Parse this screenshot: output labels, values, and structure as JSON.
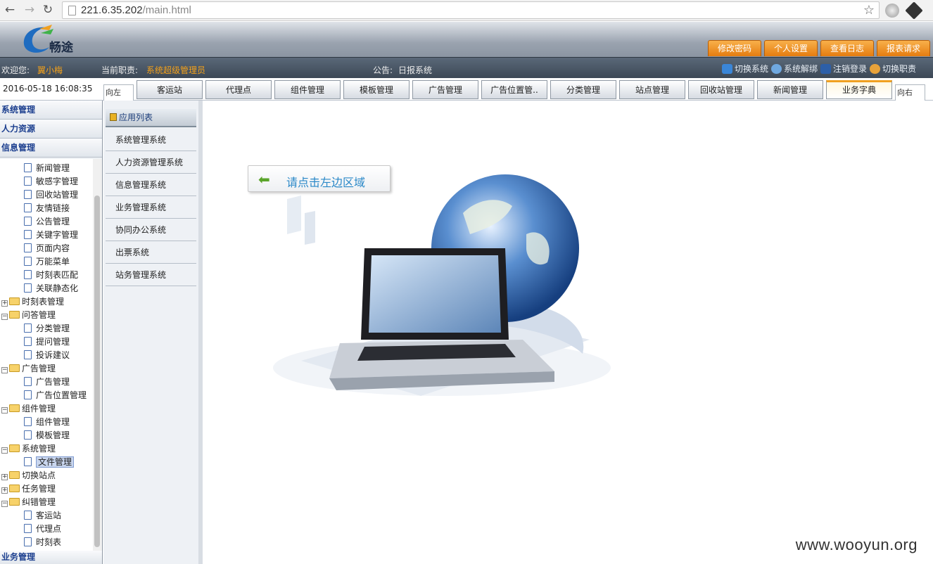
{
  "browser": {
    "url_host": "221.6.35.202",
    "url_path": "/main.html"
  },
  "header": {
    "logo_text": "畅途",
    "buttons": [
      "修改密码",
      "个人设置",
      "查看日志",
      "报表请求"
    ]
  },
  "welcome": {
    "welcome_label": "欢迎您:",
    "user_name": "翼小梅",
    "role_label": "当前职责:",
    "role_name": "系统超级管理员",
    "notice_label": "公告:",
    "notice_text": "日报系统",
    "links": [
      "切换系统",
      "系统解绑",
      "注销登录",
      "切换职责"
    ]
  },
  "tabbar": {
    "datetime": "2016-05-18 16:08:35",
    "left_btn": "向左",
    "right_btn": "向右",
    "tabs": [
      "客运站",
      "代理点",
      "组件管理",
      "模板管理",
      "广告管理",
      "广告位置管..",
      "分类管理",
      "站点管理",
      "回收站管理",
      "新闻管理",
      "业务字典"
    ],
    "active_tab": "业务字典"
  },
  "sidebar": {
    "sections": [
      "系统管理",
      "人力资源",
      "信息管理"
    ],
    "tree": [
      {
        "label": "新闻管理",
        "type": "doc",
        "level": 2
      },
      {
        "label": "敏感字管理",
        "type": "doc",
        "level": 2
      },
      {
        "label": "回收站管理",
        "type": "doc",
        "level": 2
      },
      {
        "label": "友情链接",
        "type": "doc",
        "level": 2
      },
      {
        "label": "公告管理",
        "type": "doc",
        "level": 2
      },
      {
        "label": "关键字管理",
        "type": "doc",
        "level": 2
      },
      {
        "label": "页面内容",
        "type": "doc",
        "level": 2
      },
      {
        "label": "万能菜单",
        "type": "doc",
        "level": 2
      },
      {
        "label": "时刻表匹配",
        "type": "doc",
        "level": 2
      },
      {
        "label": "关联静态化",
        "type": "doc",
        "level": 2
      },
      {
        "label": "时刻表管理",
        "type": "folder",
        "expanded": false,
        "level": 1
      },
      {
        "label": "问答管理",
        "type": "folder",
        "expanded": true,
        "level": 1
      },
      {
        "label": "分类管理",
        "type": "doc",
        "level": 2
      },
      {
        "label": "提问管理",
        "type": "doc",
        "level": 2
      },
      {
        "label": "投诉建议",
        "type": "doc",
        "level": 2
      },
      {
        "label": "广告管理",
        "type": "folder",
        "expanded": true,
        "level": 1
      },
      {
        "label": "广告管理",
        "type": "doc",
        "level": 2
      },
      {
        "label": "广告位置管理",
        "type": "doc",
        "level": 2
      },
      {
        "label": "组件管理",
        "type": "folder",
        "expanded": true,
        "level": 1
      },
      {
        "label": "组件管理",
        "type": "doc",
        "level": 2
      },
      {
        "label": "模板管理",
        "type": "doc",
        "level": 2
      },
      {
        "label": "系统管理",
        "type": "folder",
        "expanded": true,
        "level": 1
      },
      {
        "label": "文件管理",
        "type": "doc",
        "level": 2,
        "selected": true
      },
      {
        "label": "切换站点",
        "type": "folder",
        "expanded": false,
        "level": 1
      },
      {
        "label": "任务管理",
        "type": "folder",
        "expanded": false,
        "level": 1
      },
      {
        "label": "纠错管理",
        "type": "folder",
        "expanded": true,
        "level": 1
      },
      {
        "label": "客运站",
        "type": "doc",
        "level": 2
      },
      {
        "label": "代理点",
        "type": "doc",
        "level": 2
      },
      {
        "label": "时刻表",
        "type": "doc",
        "level": 2
      }
    ],
    "bottom_section": "业务管理"
  },
  "applist": {
    "title": "应用列表",
    "items": [
      "系统管理系统",
      "人力资源管理系统",
      "信息管理系统",
      "业务管理系统",
      "协同办公系统",
      "出票系统",
      "站务管理系统"
    ]
  },
  "main": {
    "hint_text": "请点击左边区域"
  },
  "watermark": "www.wooyun.org",
  "colors": {
    "accent_orange": "#f4a11a",
    "link_blue": "#1c3f8f",
    "hint_blue": "#2a88c8"
  }
}
